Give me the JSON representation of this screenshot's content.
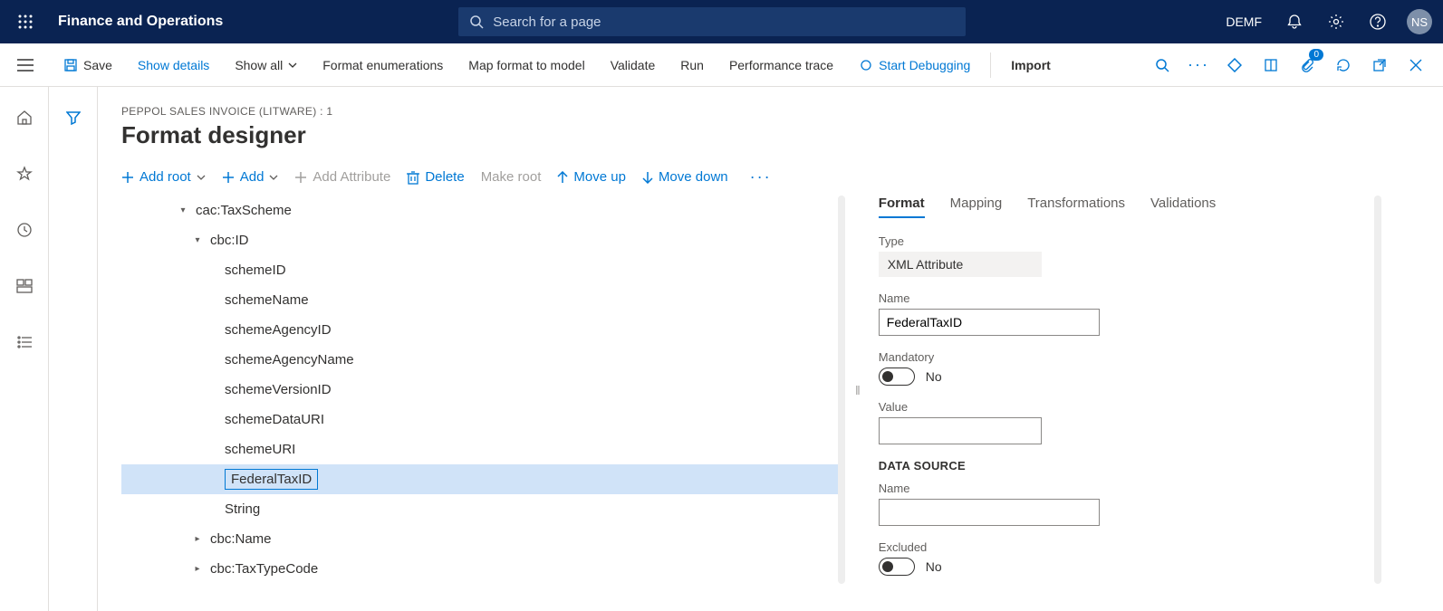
{
  "top_nav": {
    "app_title": "Finance and Operations",
    "search_placeholder": "Search for a page",
    "company": "DEMF",
    "avatar": "NS"
  },
  "action_bar": {
    "save": "Save",
    "show_details": "Show details",
    "show_all": "Show all",
    "format_enums": "Format enumerations",
    "map_format": "Map format to model",
    "validate": "Validate",
    "run": "Run",
    "perf_trace": "Performance trace",
    "start_debugging": "Start Debugging",
    "import": "Import",
    "attach_badge": "0"
  },
  "page": {
    "breadcrumb": "PEPPOL SALES INVOICE (LITWARE) : 1",
    "title": "Format designer"
  },
  "tree_toolbar": {
    "add_root": "Add root",
    "add": "Add",
    "add_attribute": "Add Attribute",
    "delete": "Delete",
    "make_root": "Make root",
    "move_up": "Move up",
    "move_down": "Move down"
  },
  "tree": {
    "n0": "cac:TaxScheme",
    "n1": "cbc:ID",
    "n2": "schemeID",
    "n3": "schemeName",
    "n4": "schemeAgencyID",
    "n5": "schemeAgencyName",
    "n6": "schemeVersionID",
    "n7": "schemeDataURI",
    "n8": "schemeURI",
    "n9": "FederalTaxID",
    "n10": "String",
    "n11": "cbc:Name",
    "n12": "cbc:TaxTypeCode"
  },
  "tabs": {
    "format": "Format",
    "mapping": "Mapping",
    "transformations": "Transformations",
    "validations": "Validations"
  },
  "props": {
    "type_label": "Type",
    "type_value": "XML Attribute",
    "name_label": "Name",
    "name_value": "FederalTaxID",
    "mandatory_label": "Mandatory",
    "mandatory_value": "No",
    "value_label": "Value",
    "data_source_heading": "DATA SOURCE",
    "ds_name_label": "Name",
    "excluded_label": "Excluded",
    "excluded_value": "No"
  }
}
